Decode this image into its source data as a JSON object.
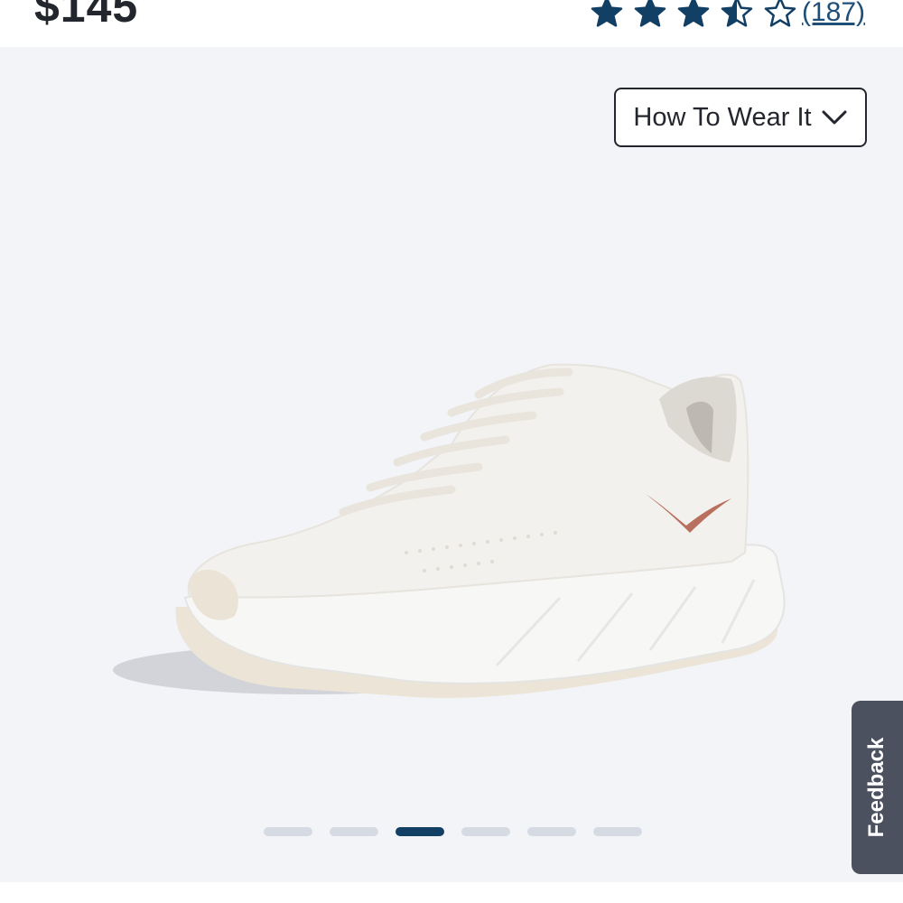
{
  "product": {
    "price": "$145",
    "rating": {
      "value": 3.5,
      "max": 5,
      "count_text": "(187)"
    }
  },
  "gallery": {
    "how_to_wear_label": "How To Wear It",
    "current_slide": 3,
    "total_slides": 6,
    "image": "white-running-shoe"
  },
  "feedback_tab": {
    "label": "Feedback"
  },
  "colors": {
    "star": "#123f64",
    "active_dot": "#123f64",
    "inactive_dot": "#d6dbe3",
    "feedback_bg": "#4c5160",
    "gallery_bg": "#f3f4f8",
    "text_dark": "#24262e"
  },
  "icons": {
    "star_full": "star-icon",
    "star_half": "star-half-icon",
    "star_empty": "star-outline-icon",
    "dropdown": "chevron-down-icon"
  }
}
